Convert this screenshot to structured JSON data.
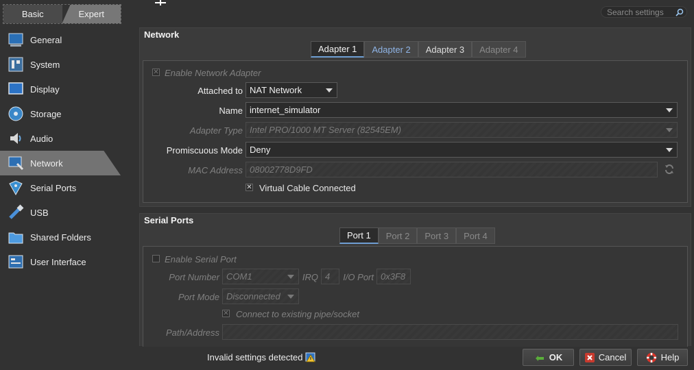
{
  "mode_switch": {
    "basic_label": "Basic",
    "expert_label": "Expert"
  },
  "search": {
    "placeholder": "Search settings"
  },
  "sidebar": {
    "items": [
      {
        "label": "General",
        "icon": "general-icon"
      },
      {
        "label": "System",
        "icon": "system-icon"
      },
      {
        "label": "Display",
        "icon": "display-icon"
      },
      {
        "label": "Storage",
        "icon": "storage-icon"
      },
      {
        "label": "Audio",
        "icon": "audio-icon"
      },
      {
        "label": "Network",
        "icon": "network-icon",
        "selected": true
      },
      {
        "label": "Serial Ports",
        "icon": "serial-ports-icon"
      },
      {
        "label": "USB",
        "icon": "usb-icon"
      },
      {
        "label": "Shared Folders",
        "icon": "shared-folders-icon"
      },
      {
        "label": "User Interface",
        "icon": "user-interface-icon"
      }
    ]
  },
  "network": {
    "title": "Network",
    "tabs": [
      "Adapter 1",
      "Adapter 2",
      "Adapter 3",
      "Adapter 4"
    ],
    "active_tab": "Adapter 1",
    "enable_label": "Enable Network Adapter",
    "attached_to": {
      "label": "Attached to",
      "value": "NAT Network"
    },
    "name": {
      "label": "Name",
      "value": "internet_simulator"
    },
    "adapter_type": {
      "label": "Adapter Type",
      "value": "Intel PRO/1000 MT Server (82545EM)"
    },
    "promiscuous": {
      "label": "Promiscuous Mode",
      "value": "Deny"
    },
    "mac": {
      "label": "MAC Address",
      "value": "08002778D9FD"
    },
    "cable_label": "Virtual Cable Connected"
  },
  "serial": {
    "title": "Serial Ports",
    "tabs": [
      "Port 1",
      "Port 2",
      "Port 3",
      "Port 4"
    ],
    "active_tab": "Port 1",
    "enable_label": "Enable Serial Port",
    "port_number": {
      "label": "Port Number",
      "value": "COM1"
    },
    "irq": {
      "label": "IRQ",
      "value": "4"
    },
    "io_port": {
      "label": "I/O Port",
      "value": "0x3F8"
    },
    "port_mode": {
      "label": "Port Mode",
      "value": "Disconnected"
    },
    "connect_label": "Connect to existing pipe/socket",
    "path_label": "Path/Address"
  },
  "footer": {
    "status": "Invalid settings detected",
    "ok_label": "OK",
    "cancel_label": "Cancel",
    "help_label": "Help"
  },
  "colors": {
    "background": "#323232",
    "selected_item": "#737373",
    "link_tab": "#8fb4e6"
  }
}
